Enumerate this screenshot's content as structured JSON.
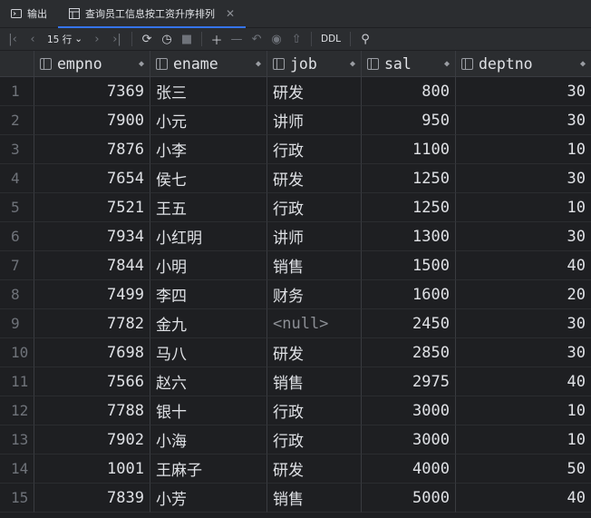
{
  "tabs": [
    {
      "label": "输出",
      "active": false
    },
    {
      "label": "查询员工信息按工资升序排列",
      "active": true
    }
  ],
  "toolbar": {
    "rows_label": "15 行",
    "ddl_label": "DDL"
  },
  "columns": [
    "empno",
    "ename",
    "job",
    "sal",
    "deptno"
  ],
  "rows": [
    {
      "i": "1",
      "empno": "7369",
      "ename": "张三",
      "job": "研发",
      "sal": "800",
      "deptno": "30"
    },
    {
      "i": "2",
      "empno": "7900",
      "ename": "小元",
      "job": "讲师",
      "sal": "950",
      "deptno": "30"
    },
    {
      "i": "3",
      "empno": "7876",
      "ename": "小李",
      "job": "行政",
      "sal": "1100",
      "deptno": "10"
    },
    {
      "i": "4",
      "empno": "7654",
      "ename": "侯七",
      "job": "研发",
      "sal": "1250",
      "deptno": "30"
    },
    {
      "i": "5",
      "empno": "7521",
      "ename": "王五",
      "job": "行政",
      "sal": "1250",
      "deptno": "10"
    },
    {
      "i": "6",
      "empno": "7934",
      "ename": "小红明",
      "job": "讲师",
      "sal": "1300",
      "deptno": "30"
    },
    {
      "i": "7",
      "empno": "7844",
      "ename": "小明",
      "job": "销售",
      "sal": "1500",
      "deptno": "40"
    },
    {
      "i": "8",
      "empno": "7499",
      "ename": "李四",
      "job": "财务",
      "sal": "1600",
      "deptno": "20"
    },
    {
      "i": "9",
      "empno": "7782",
      "ename": "金九",
      "job": "<null>",
      "sal": "2450",
      "deptno": "30"
    },
    {
      "i": "10",
      "empno": "7698",
      "ename": "马八",
      "job": "研发",
      "sal": "2850",
      "deptno": "30"
    },
    {
      "i": "11",
      "empno": "7566",
      "ename": "赵六",
      "job": "销售",
      "sal": "2975",
      "deptno": "40"
    },
    {
      "i": "12",
      "empno": "7788",
      "ename": "银十",
      "job": "行政",
      "sal": "3000",
      "deptno": "10"
    },
    {
      "i": "13",
      "empno": "7902",
      "ename": "小海",
      "job": "行政",
      "sal": "3000",
      "deptno": "10"
    },
    {
      "i": "14",
      "empno": "1001",
      "ename": "王麻子",
      "job": "研发",
      "sal": "4000",
      "deptno": "50"
    },
    {
      "i": "15",
      "empno": "7839",
      "ename": "小芳",
      "job": "销售",
      "sal": "5000",
      "deptno": "40"
    }
  ],
  "icons": [
    "console-icon",
    "table-icon",
    "close-icon",
    "first-page-icon",
    "prev-page-icon",
    "next-page-icon",
    "last-page-icon",
    "reload-icon",
    "history-icon",
    "stop-icon",
    "add-row-icon",
    "delete-row-icon",
    "revert-icon",
    "preview-icon",
    "submit-icon",
    "pin-icon",
    "column-icon",
    "sort-icon"
  ]
}
